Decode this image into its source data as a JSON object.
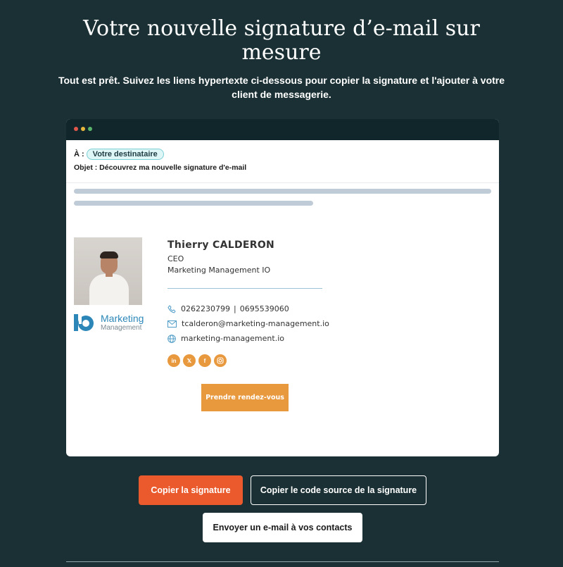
{
  "hero": {
    "title": "Votre nouvelle signature d’e-mail sur mesure",
    "subtitle": "Tout est prêt. Suivez les liens hypertexte ci-dessous pour copier la signature et l'ajouter à votre client de messagerie."
  },
  "email_preview": {
    "to_label": "À :",
    "recipient": "Votre destinataire",
    "subject": "Objet : Découvrez ma nouvelle signature d'e-mail"
  },
  "signature": {
    "name": "Thierry CALDERON",
    "role": "CEO",
    "company": "Marketing Management IO",
    "phone1": "0262230799",
    "phone_separator": "|",
    "phone2": "0695539060",
    "email": "tcalderon@marketing-management.io",
    "website": "marketing-management.io",
    "logo_line1": "Marketing",
    "logo_line2": "Management",
    "socials": [
      "linkedin-icon",
      "x-icon",
      "facebook-icon",
      "instagram-icon"
    ],
    "cta_label": "Prendre rendez-vous",
    "accent_color": "#e8993e"
  },
  "actions": {
    "copy_signature": "Copier la signature",
    "copy_source": "Copier le code source de la signature",
    "send_email": "Envoyer un e-mail à vos contacts"
  },
  "colors": {
    "background": "#1a3034",
    "primary_button": "#ea5a2c"
  }
}
